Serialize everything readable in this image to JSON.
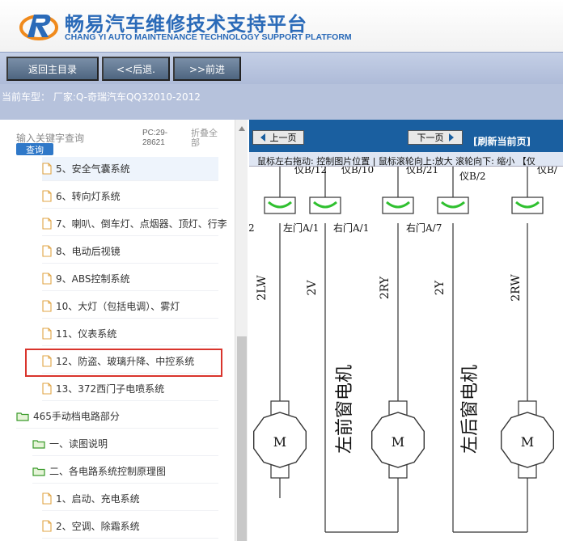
{
  "header": {
    "title_cn": "畅易汽车维修技术支持平台",
    "title_en": "CHANG YI AUTO MAINTENANCE TECHNOLOGY SUPPORT PLATFORM",
    "brand_color": "#2a6ab8"
  },
  "toolbar": {
    "home_label": "返回主目录",
    "back_label": "<<后退.",
    "forward_label": ">>前进"
  },
  "car": {
    "label": "当前车型： 厂家:Q-奇瑞汽车QQ32010-2012"
  },
  "search": {
    "placeholder": "输入关键字查询",
    "button_label": "查询",
    "pc_label": "PC:29-28621",
    "fold_label": "折叠全部"
  },
  "tree": {
    "items": [
      {
        "label": "5、安全气囊系统",
        "type": "file"
      },
      {
        "label": "6、转向灯系统",
        "type": "file"
      },
      {
        "label": "7、喇叭、倒车灯、点烟器、顶灯、行李",
        "type": "file"
      },
      {
        "label": "8、电动后视镜",
        "type": "file"
      },
      {
        "label": "9、ABS控制系统",
        "type": "file"
      },
      {
        "label": "10、大灯（包括电调）、雾灯",
        "type": "file"
      },
      {
        "label": "11、仪表系统",
        "type": "file"
      },
      {
        "label": "12、防盗、玻璃升降、中控系统",
        "type": "file",
        "highlighted": true
      },
      {
        "label": "13、372西门子电喷系统",
        "type": "file"
      },
      {
        "label": "465手动档电路部分",
        "type": "folder"
      },
      {
        "label": "一、读图说明",
        "type": "folder"
      },
      {
        "label": "二、各电路系统控制原理图",
        "type": "folder"
      },
      {
        "label": "1、启动、充电系统",
        "type": "file"
      },
      {
        "label": "2、空调、除霜系统",
        "type": "file"
      }
    ]
  },
  "viewer": {
    "prev_label": "上一页",
    "next_label": "下一页",
    "refresh_label": "[刷新当前页]",
    "hint": "鼠标左右拖动: 控制图片位置 | 鼠标滚轮向上:放大 滚轮向下: 缩小 【仅"
  },
  "diagram_text": {
    "conn_labels": [
      "仪B/12",
      "仪B/10",
      "仪B/21",
      "仪B/2"
    ],
    "conn_label_partial": "仪B/",
    "door_labels": [
      "2",
      "左门A/1",
      "右门A/1",
      "右门A/7"
    ],
    "wire_labels": [
      "2LW",
      "2V",
      "2RY",
      "2Y",
      "2RW"
    ],
    "motor_label": "M",
    "front_motor": "左前窗电机",
    "rear_motor": "左后窗电机"
  }
}
